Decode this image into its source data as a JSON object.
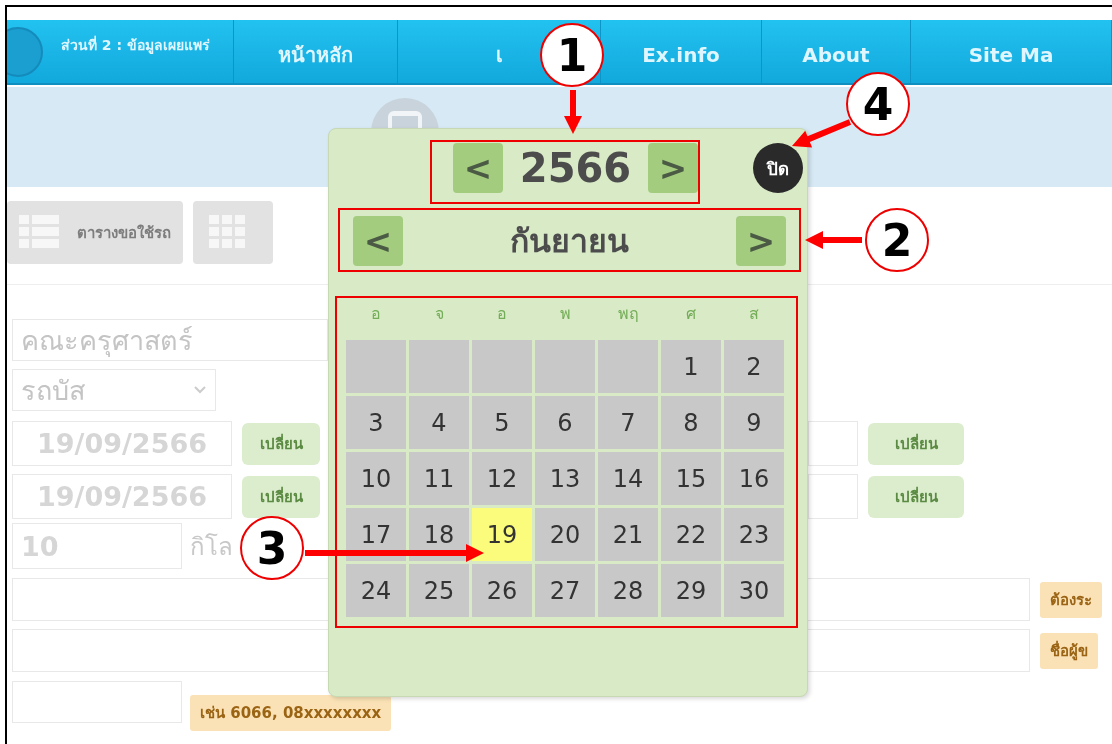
{
  "nav": {
    "brand": "ส่วนที่ 2 : ข้อมูลเผยแพร่",
    "items": [
      {
        "label": "หน้าหลัก"
      },
      {
        "label": "เ"
      },
      {
        "label": "Ex.info"
      },
      {
        "label": "About"
      },
      {
        "label": "Site Ma"
      }
    ]
  },
  "toolbar": {
    "buttons": [
      {
        "kind": "table",
        "label": "ตารางขอใช้รถ"
      },
      {
        "kind": "grid"
      }
    ]
  },
  "form": {
    "faculty": "คณะครุศาสตร์",
    "vehicle": "รถบัส",
    "dates": [
      {
        "value": "19/09/2566",
        "button": "เปลี่ยน",
        "right_button": "เปลี่ยน"
      },
      {
        "value": "19/09/2566",
        "button": "เปลี่ยน",
        "right_button": "เปลี่ยน"
      }
    ],
    "distance": {
      "value": "10",
      "unit": "กิโล"
    },
    "notes": [
      {
        "badge": "ต้องระ"
      },
      {
        "badge": "ชื่อผู้ข"
      }
    ],
    "phone": {
      "hint": "เช่น 6066, 08xxxxxxxx"
    }
  },
  "calendar": {
    "prev_label": "<",
    "next_label": ">",
    "year": "2566",
    "month": "กันยายน",
    "close": "ปิด",
    "weekdays": [
      "อ",
      "จ",
      "อ",
      "พ",
      "พฤ",
      "ศ",
      "ส"
    ],
    "weeks": [
      [
        {
          "kind": "blank"
        },
        {
          "kind": "blank"
        },
        {
          "kind": "blank"
        },
        {
          "kind": "blank"
        },
        {
          "kind": "blank"
        },
        {
          "kind": "day",
          "day": "1",
          "selected": false
        },
        {
          "kind": "day",
          "day": "2",
          "selected": false
        }
      ],
      [
        {
          "kind": "day",
          "day": "3",
          "selected": false
        },
        {
          "kind": "day",
          "day": "4",
          "selected": false
        },
        {
          "kind": "day",
          "day": "5",
          "selected": false
        },
        {
          "kind": "day",
          "day": "6",
          "selected": false
        },
        {
          "kind": "day",
          "day": "7",
          "selected": false
        },
        {
          "kind": "day",
          "day": "8",
          "selected": false
        },
        {
          "kind": "day",
          "day": "9",
          "selected": false
        }
      ],
      [
        {
          "kind": "day",
          "day": "10",
          "selected": false
        },
        {
          "kind": "day",
          "day": "11",
          "selected": false
        },
        {
          "kind": "day",
          "day": "12",
          "selected": false
        },
        {
          "kind": "day",
          "day": "13",
          "selected": false
        },
        {
          "kind": "day",
          "day": "14",
          "selected": false
        },
        {
          "kind": "day",
          "day": "15",
          "selected": false
        },
        {
          "kind": "day",
          "day": "16",
          "selected": false
        }
      ],
      [
        {
          "kind": "day",
          "day": "17",
          "selected": false
        },
        {
          "kind": "day",
          "day": "18",
          "selected": false
        },
        {
          "kind": "day",
          "day": "19",
          "selected": true
        },
        {
          "kind": "day",
          "day": "20",
          "selected": false
        },
        {
          "kind": "day",
          "day": "21",
          "selected": false
        },
        {
          "kind": "day",
          "day": "22",
          "selected": false
        },
        {
          "kind": "day",
          "day": "23",
          "selected": false
        }
      ],
      [
        {
          "kind": "day",
          "day": "24",
          "selected": false
        },
        {
          "kind": "day",
          "day": "25",
          "selected": false
        },
        {
          "kind": "day",
          "day": "26",
          "selected": false
        },
        {
          "kind": "day",
          "day": "27",
          "selected": false
        },
        {
          "kind": "day",
          "day": "28",
          "selected": false
        },
        {
          "kind": "day",
          "day": "29",
          "selected": false
        },
        {
          "kind": "day",
          "day": "30",
          "selected": false
        }
      ]
    ]
  },
  "annotations": [
    {
      "number": "1"
    },
    {
      "number": "2"
    },
    {
      "number": "3"
    },
    {
      "number": "4"
    }
  ]
}
